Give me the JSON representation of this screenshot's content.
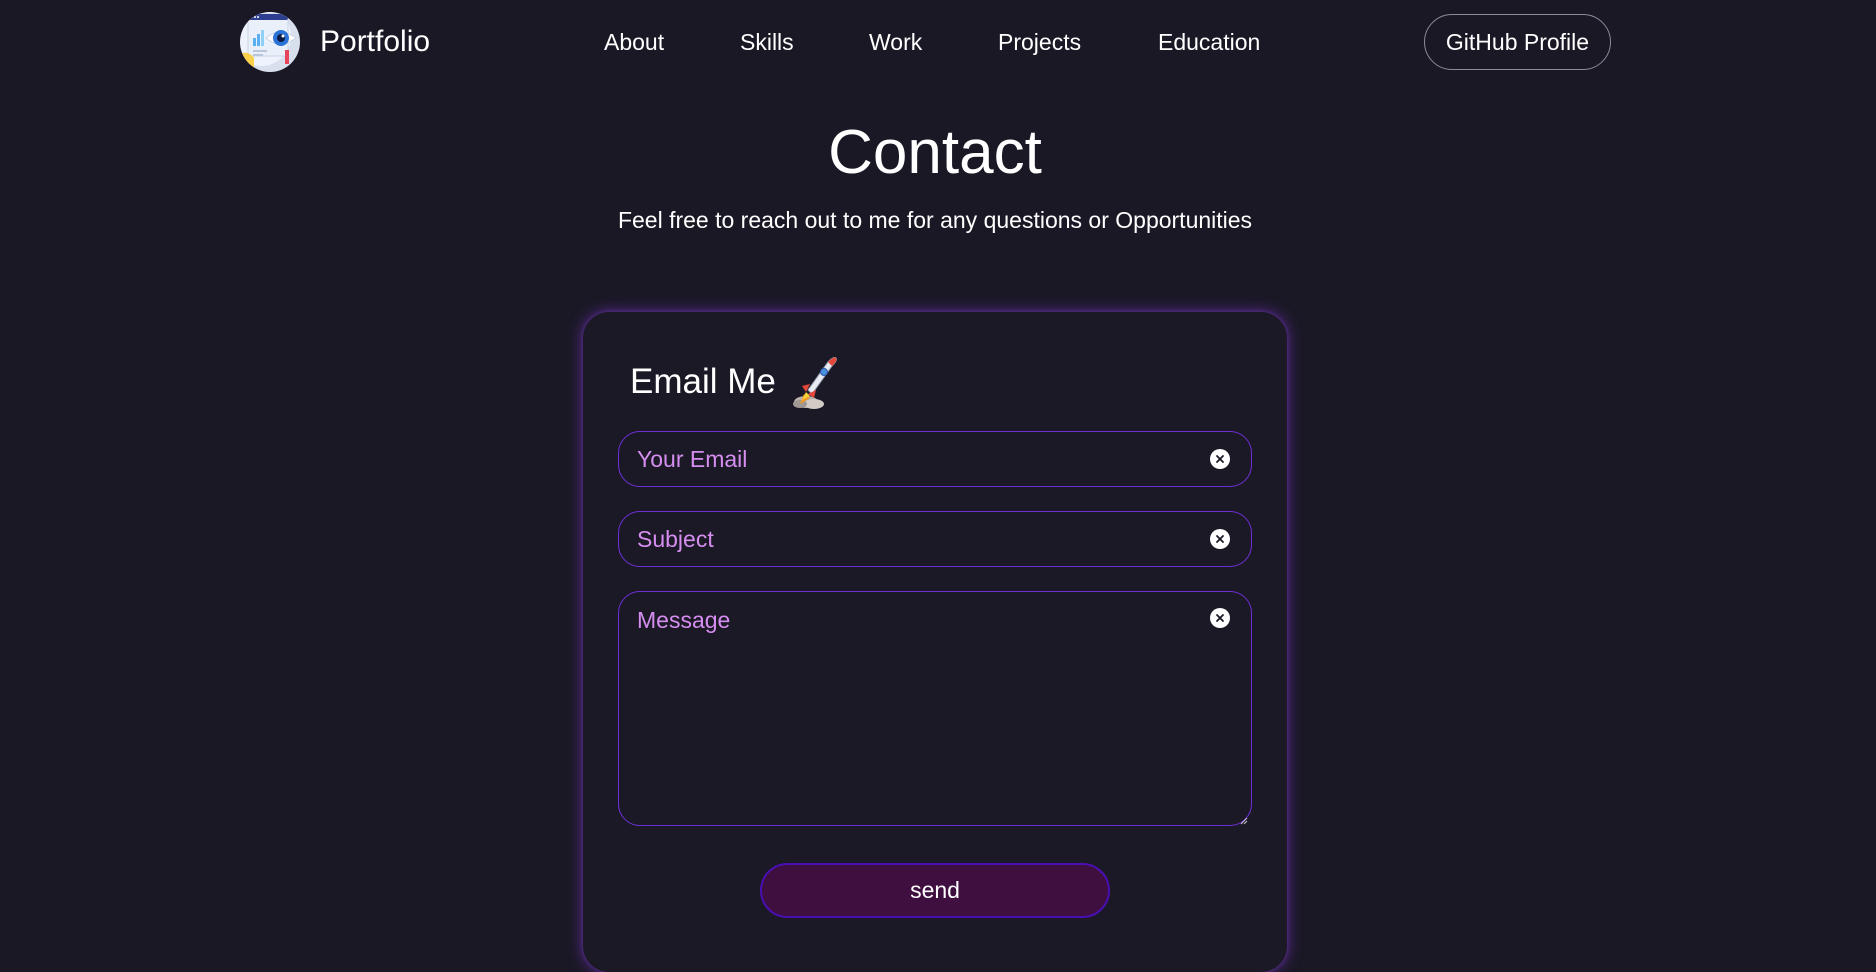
{
  "navbar": {
    "brand_name": "Portfolio",
    "brand_logo_icon": "analytics-eye-logo",
    "links": [
      "About",
      "Skills",
      "Work",
      "Projects",
      "Education"
    ],
    "github_button": "GitHub Profile"
  },
  "contact": {
    "title": "Contact",
    "subtitle": "Feel free to reach out to me for any questions or Opportunities"
  },
  "form": {
    "heading": "Email Me",
    "heading_icon": "rocket-icon",
    "email_placeholder": "Your Email",
    "email_value": "",
    "subject_placeholder": "Subject",
    "subject_value": "",
    "message_placeholder": "Message",
    "message_value": "",
    "clear_icon": "clear-icon",
    "send_label": "send"
  },
  "colors": {
    "background": "#1a1825",
    "card": "#1b1925",
    "field_border": "#6f2fd7",
    "placeholder": "#d58ef0",
    "send_button_fill": "#3f0f3f",
    "send_button_border": "#4a0fb3",
    "card_glow": "#7a34c8"
  }
}
